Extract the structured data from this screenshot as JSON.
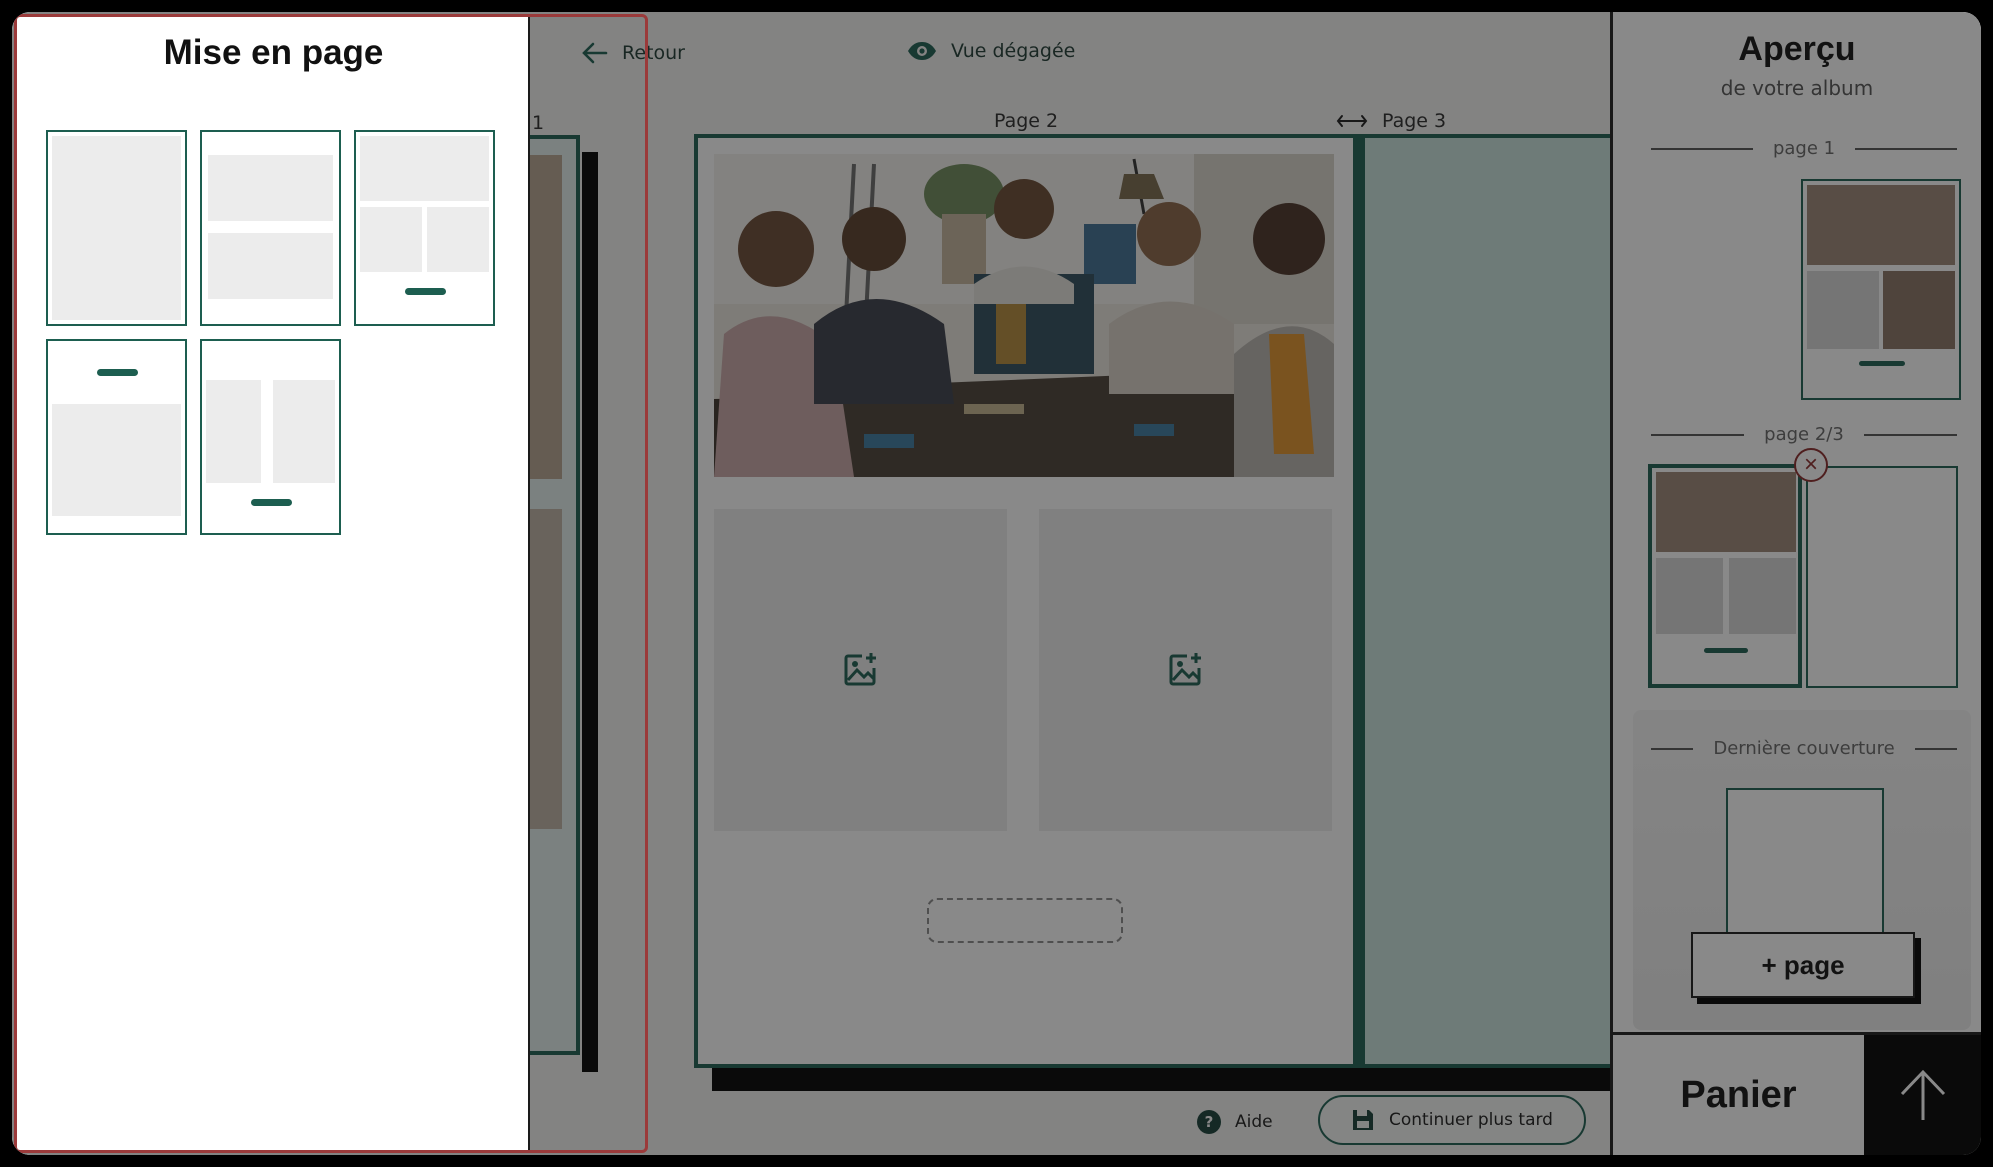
{
  "editor": {
    "back_label": "Retour",
    "clear_view_label": "Vue dégagée",
    "page1_label": "1",
    "page2_label": "Page 2",
    "page3_label": "Page 3",
    "help_label": "Aide",
    "continue_label": "Continuer plus tard"
  },
  "layout_panel": {
    "title": "Mise en page"
  },
  "preview": {
    "title": "Aperçu",
    "subtitle": "de votre album",
    "section_page1": "page 1",
    "section_page23": "page 2/3",
    "section_last_cover": "Dernière couverture",
    "add_page_label": "+ page",
    "cart_label": "Panier"
  },
  "colors": {
    "accent": "#1d5e50",
    "panel_border": "#9b3a3a",
    "remove_badge": "#8a2b2b"
  },
  "icons": {
    "back": "arrow-left-icon",
    "clear_view": "eye-icon",
    "swap": "swap-arrows-icon",
    "add_image": "add-image-icon",
    "help": "question-icon",
    "save": "floppy-disk-icon",
    "remove": "close-icon",
    "scroll_up": "arrow-up-icon"
  }
}
